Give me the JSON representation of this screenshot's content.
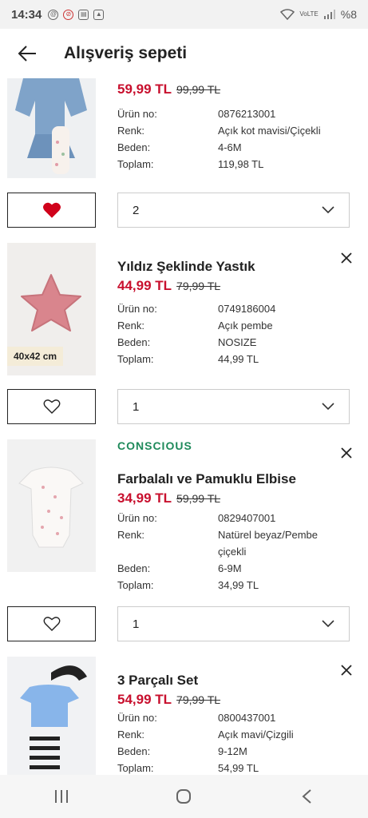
{
  "status_bar": {
    "time": "14:34",
    "network": "VoLTE",
    "battery": "%8"
  },
  "header": {
    "title": "Alışveriş sepeti"
  },
  "labels": {
    "product_no": "Ürün no:",
    "color": "Renk:",
    "size": "Beden:",
    "total": "Toplam:"
  },
  "items": [
    {
      "name": "",
      "price_now": "59,99 TL",
      "price_old": "99,99 TL",
      "product_no": "0876213001",
      "color": "Açık kot mavisi/Çiçekli",
      "size": "4-6M",
      "total": "119,98 TL",
      "quantity": "2",
      "favorite": true
    },
    {
      "name": "Yıldız Şeklinde Yastık",
      "price_now": "44,99 TL",
      "price_old": "79,99 TL",
      "product_no": "0749186004",
      "color": "Açık pembe",
      "size": "NOSIZE",
      "total": "44,99 TL",
      "quantity": "1",
      "size_tag": "40x42 cm",
      "favorite": false
    },
    {
      "tag": "CONSCIOUS",
      "name": "Farbalalı ve Pamuklu Elbise",
      "price_now": "34,99 TL",
      "price_old": "59,99 TL",
      "product_no": "0829407001",
      "color": "Natürel beyaz/Pembe çiçekli",
      "size": "6-9M",
      "total": "34,99 TL",
      "quantity": "1",
      "favorite": false
    },
    {
      "name": "3 Parçalı Set",
      "price_now": "54,99 TL",
      "price_old": "79,99 TL",
      "product_no": "0800437001",
      "color": "Açık mavi/Çizgili",
      "size": "9-12M",
      "total": "54,99 TL",
      "quantity": "",
      "favorite": false
    }
  ],
  "icons": {
    "back": "arrow-left-icon",
    "remove": "close-icon",
    "favorite": "heart-icon",
    "dropdown": "chevron-down-icon"
  },
  "colors": {
    "sale_price": "#c8102e",
    "conscious_tag": "#1f8a5b",
    "heart_filled": "#d0021b"
  }
}
